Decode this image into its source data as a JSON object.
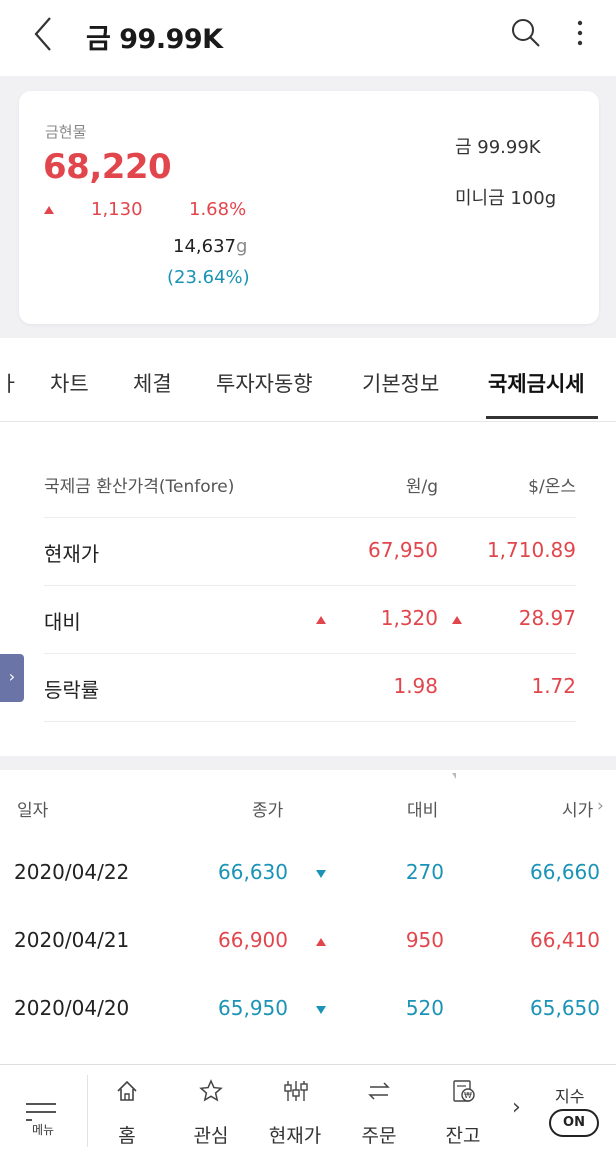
{
  "header": {
    "title": "금 99.99K",
    "icons": {
      "back": "chevron-left-icon",
      "search": "search-icon",
      "more": "more-vertical-icon"
    }
  },
  "summary": {
    "label": "금현물",
    "price": "68,220",
    "change": "1,130",
    "change_rate": "1.68%",
    "volume": "14,637",
    "volume_unit": "g",
    "volume_ratio": "(23.64%)",
    "product_1": "금 99.99K",
    "product_2": "미니금 100g"
  },
  "tabs": {
    "cut_prev": "ㅏ",
    "items": [
      "차트",
      "체결",
      "투자자동향",
      "기본정보",
      "국제금시세"
    ],
    "active_index": 4
  },
  "intl_gold": {
    "header": {
      "label": "국제금 환산가격(Tenfore)",
      "col1": "원/g",
      "col2": "$/온스"
    },
    "rows": [
      {
        "label": "현재가",
        "won": "67,950",
        "usd": "1,710.89"
      },
      {
        "label": "대비",
        "won": "1,320",
        "usd": "28.97"
      },
      {
        "label": "등락률",
        "won": "1.98",
        "usd": "1.72"
      }
    ]
  },
  "daily": {
    "headers": {
      "date": "일자",
      "close": "종가",
      "change": "대비",
      "open": "시가"
    },
    "rows": [
      {
        "date": "2020/04/22",
        "close": "66,630",
        "dir": "down",
        "change": "270",
        "open": "66,660"
      },
      {
        "date": "2020/04/21",
        "close": "66,900",
        "dir": "up",
        "change": "950",
        "open": "66,410"
      },
      {
        "date": "2020/04/20",
        "close": "65,950",
        "dir": "down",
        "change": "520",
        "open": "65,650"
      }
    ]
  },
  "bottom_nav": {
    "menu_label": "메뉴",
    "items": [
      {
        "label": "홈",
        "icon": "home-icon"
      },
      {
        "label": "관심",
        "icon": "star-icon"
      },
      {
        "label": "현재가",
        "icon": "sliders-icon"
      },
      {
        "label": "주문",
        "icon": "swap-icon"
      },
      {
        "label": "잔고",
        "icon": "wallet-icon"
      }
    ],
    "index_label": "지수",
    "index_toggle": "ON"
  },
  "colors": {
    "up": "#e2464d",
    "down": "#1a93b6",
    "handle": "#6a74a6"
  }
}
